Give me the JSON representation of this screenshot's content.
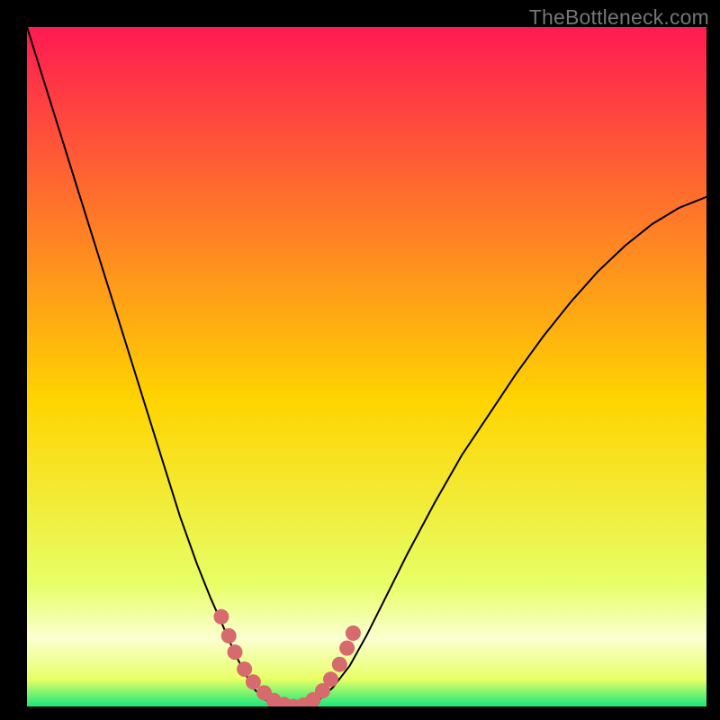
{
  "watermark": "TheBottleneck.com",
  "colors": {
    "bg": "#000000",
    "curve": "#000000",
    "marker": "#d76a6d",
    "gradient_top": "#ff1a52",
    "gradient_mid": "#ffd400",
    "gradient_low": "#e7ff66",
    "gradient_band": "#fbffd0",
    "gradient_bottom": "#17e87a",
    "watermark": "#767676"
  },
  "chart_data": {
    "type": "line",
    "title": "",
    "xlabel": "",
    "ylabel": "",
    "xlim": [
      0,
      1
    ],
    "ylim": [
      0,
      1
    ],
    "series": [
      {
        "name": "bottleneck-curve",
        "x": [
          0.0,
          0.025,
          0.05,
          0.075,
          0.1,
          0.125,
          0.15,
          0.175,
          0.2,
          0.225,
          0.25,
          0.27,
          0.29,
          0.305,
          0.32,
          0.335,
          0.35,
          0.37,
          0.39,
          0.41,
          0.43,
          0.45,
          0.475,
          0.5,
          0.53,
          0.56,
          0.6,
          0.64,
          0.68,
          0.72,
          0.76,
          0.8,
          0.84,
          0.88,
          0.92,
          0.96,
          1.0
        ],
        "y": [
          1.0,
          0.92,
          0.84,
          0.76,
          0.68,
          0.6,
          0.52,
          0.44,
          0.36,
          0.28,
          0.21,
          0.16,
          0.115,
          0.08,
          0.05,
          0.025,
          0.01,
          0.003,
          0.0,
          0.002,
          0.01,
          0.028,
          0.06,
          0.105,
          0.165,
          0.225,
          0.3,
          0.37,
          0.43,
          0.49,
          0.545,
          0.595,
          0.64,
          0.678,
          0.71,
          0.734,
          0.75
        ]
      }
    ],
    "markers": {
      "name": "highlighted-points",
      "x": [
        0.286,
        0.297,
        0.306,
        0.32,
        0.333,
        0.349,
        0.363,
        0.378,
        0.392,
        0.407,
        0.421,
        0.435,
        0.447,
        0.46,
        0.471,
        0.48
      ],
      "y": [
        0.132,
        0.104,
        0.08,
        0.055,
        0.036,
        0.02,
        0.009,
        0.003,
        0.0,
        0.002,
        0.01,
        0.023,
        0.04,
        0.062,
        0.086,
        0.108
      ]
    }
  }
}
